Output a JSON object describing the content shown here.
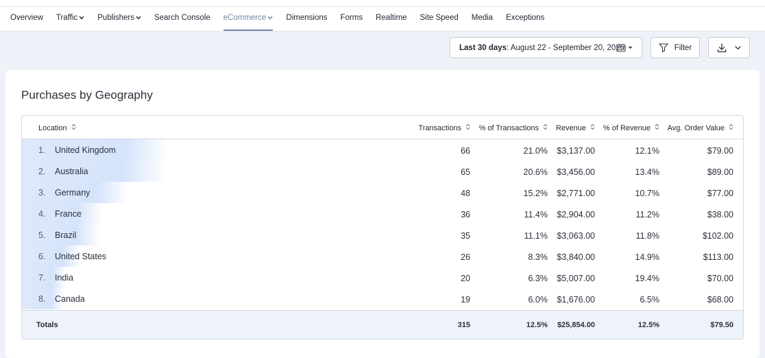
{
  "nav": {
    "items": [
      {
        "label": "Overview",
        "dropdown": false,
        "active": false
      },
      {
        "label": "Traffic",
        "dropdown": true,
        "active": false
      },
      {
        "label": "Publishers",
        "dropdown": true,
        "active": false
      },
      {
        "label": "Search Console",
        "dropdown": false,
        "active": false
      },
      {
        "label": "eCommerce",
        "dropdown": true,
        "active": true
      },
      {
        "label": "Dimensions",
        "dropdown": false,
        "active": false
      },
      {
        "label": "Forms",
        "dropdown": false,
        "active": false
      },
      {
        "label": "Realtime",
        "dropdown": false,
        "active": false
      },
      {
        "label": "Site Speed",
        "dropdown": false,
        "active": false
      },
      {
        "label": "Media",
        "dropdown": false,
        "active": false
      },
      {
        "label": "Exceptions",
        "dropdown": false,
        "active": false
      }
    ]
  },
  "toolbar": {
    "date_prefix": "Last 30 days",
    "date_range": ": August 22 - September 20, 2026",
    "filter_label": "Filter"
  },
  "card": {
    "title": "Purchases by Geography"
  },
  "table": {
    "columns": [
      "Location",
      "Transactions",
      "% of Transactions",
      "Revenue",
      "% of Revenue",
      "Avg. Order Value"
    ],
    "rows": [
      {
        "rank": "1.",
        "location": "United Kingdom",
        "transactions": "66",
        "pct_transactions": "21.0%",
        "revenue": "$3,137.00",
        "pct_revenue": "12.1%",
        "aov": "$79.00",
        "share": 0.21
      },
      {
        "rank": "2.",
        "location": "Australia",
        "transactions": "65",
        "pct_transactions": "20.6%",
        "revenue": "$3,456.00",
        "pct_revenue": "13.4%",
        "aov": "$89.00",
        "share": 0.206
      },
      {
        "rank": "3.",
        "location": "Germany",
        "transactions": "48",
        "pct_transactions": "15.2%",
        "revenue": "$2,771.00",
        "pct_revenue": "10.7%",
        "aov": "$77.00",
        "share": 0.152
      },
      {
        "rank": "4.",
        "location": "France",
        "transactions": "36",
        "pct_transactions": "11.4%",
        "revenue": "$2,904.00",
        "pct_revenue": "11.2%",
        "aov": "$38.00",
        "share": 0.114
      },
      {
        "rank": "5.",
        "location": "Brazil",
        "transactions": "35",
        "pct_transactions": "11.1%",
        "revenue": "$3,063.00",
        "pct_revenue": "11.8%",
        "aov": "$102.00",
        "share": 0.111
      },
      {
        "rank": "6.",
        "location": "United States",
        "transactions": "26",
        "pct_transactions": "8.3%",
        "revenue": "$3,840.00",
        "pct_revenue": "14.9%",
        "aov": "$113.00",
        "share": 0.083
      },
      {
        "rank": "7.",
        "location": "India",
        "transactions": "20",
        "pct_transactions": "6.3%",
        "revenue": "$5,007.00",
        "pct_revenue": "19.4%",
        "aov": "$70.00",
        "share": 0.063
      },
      {
        "rank": "8.",
        "location": "Canada",
        "transactions": "19",
        "pct_transactions": "6.0%",
        "revenue": "$1,676.00",
        "pct_revenue": "6.5%",
        "aov": "$68.00",
        "share": 0.06
      }
    ],
    "totals": {
      "label": "Totals",
      "transactions": "315",
      "pct_transactions": "12.5%",
      "revenue": "$25,854.00",
      "pct_revenue": "12.5%",
      "aov": "$79.50"
    }
  },
  "colors": {
    "accent": "#6f87a8",
    "row_highlight": "#d5e4fb",
    "totals_bg": "#eef3fb"
  }
}
